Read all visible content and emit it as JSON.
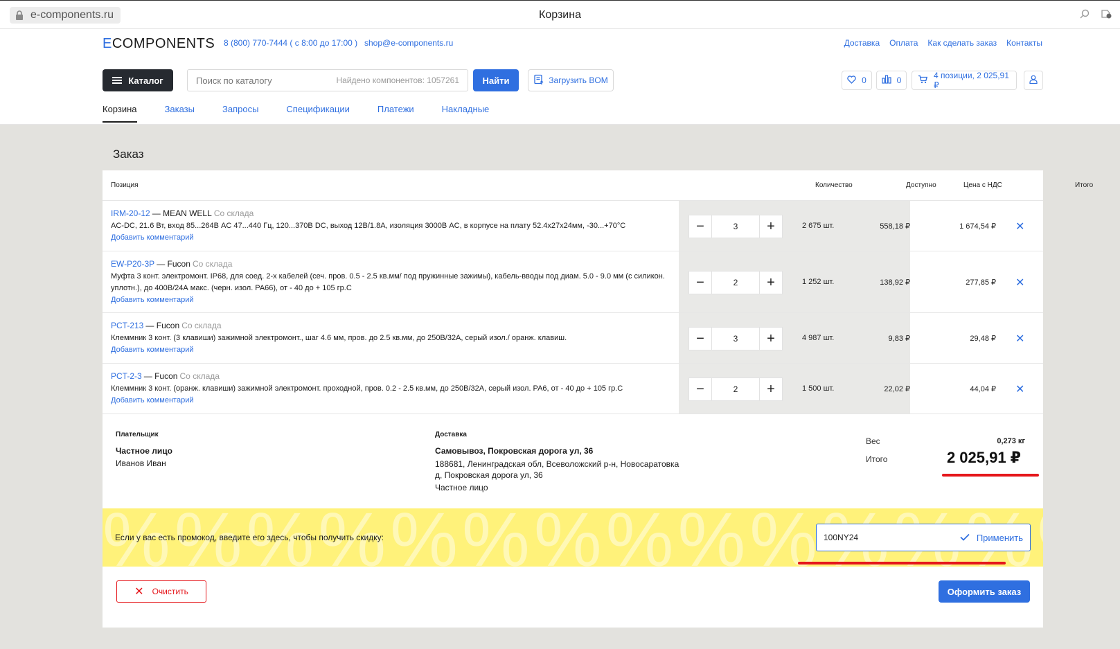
{
  "browser": {
    "url": "e-components.ru",
    "tab_title": "Корзина"
  },
  "header": {
    "logo_first": "E",
    "logo_rest": "COMPONENTS",
    "phone": "8 (800) 770-7444 ( с 8:00 до 17:00 )",
    "email": "shop@e-components.ru",
    "top_links": [
      "Доставка",
      "Оплата",
      "Как сделать заказ",
      "Контакты"
    ],
    "catalog_label": "Каталог",
    "search_placeholder": "Поиск по каталогу",
    "search_found": "Найдено компонентов: 1057261",
    "find_label": "Найти",
    "bom_label": "Загрузить BOM",
    "favorites_count": "0",
    "compare_count": "0",
    "cart_summary": "4 позиции, 2 025,91 ₽",
    "subtabs": [
      "Корзина",
      "Заказы",
      "Запросы",
      "Спецификации",
      "Платежи",
      "Накладные"
    ]
  },
  "order": {
    "title": "Заказ",
    "columns": {
      "position": "Позиция",
      "quantity": "Количество",
      "available": "Доступно",
      "price": "Цена с НДС",
      "total": "Итого"
    },
    "items": [
      {
        "pn": "IRM-20-12",
        "brand": "MEAN WELL",
        "source": "Со склада",
        "desc": "AC-DC, 21.6 Вт, вход 85...264В AC 47...440 Гц, 120...370В DC, выход 12В/1.8А, изоляция 3000В AC, в корпусе на плату 52.4x27x24мм, -30...+70°C",
        "comment": "Добавить комментарий",
        "qty": "3",
        "available": "2 675 шт.",
        "price": "558,18 ₽",
        "total": "1 674,54 ₽"
      },
      {
        "pn": "EW-P20-3P",
        "brand": "Fucon",
        "source": "Со склада",
        "desc": "Муфта 3 конт. электромонт. IP68, для соед. 2-х кабелей (сеч. пров. 0.5 - 2.5 кв.мм/ под пружинные зажимы), кабель-вводы под диам. 5.0 - 9.0 мм (с силикон. уплотн.), до 400В/24А макс. (черн. изол. PA66), от - 40 до + 105 гр.С",
        "comment": "Добавить комментарий",
        "qty": "2",
        "available": "1 252 шт.",
        "price": "138,92 ₽",
        "total": "277,85 ₽"
      },
      {
        "pn": "PCT-213",
        "brand": "Fucon",
        "source": "Со склада",
        "desc": "Клеммник 3 конт. (3 клавиши) зажимной электромонт., шаг 4.6 мм, пров. до 2.5 кв.мм, до 250В/32А, серый изол./ оранж. клавиш.",
        "comment": "Добавить комментарий",
        "qty": "3",
        "available": "4 987 шт.",
        "price": "9,83 ₽",
        "total": "29,48 ₽"
      },
      {
        "pn": "PCT-2-3",
        "brand": "Fucon",
        "source": "Со склада",
        "desc": "Клеммник 3 конт. (оранж. клавиши) зажимной электромонт. проходной, пров. 0.2 - 2.5 кв.мм, до 250В/32А, серый изол. PA6, от - 40 до + 105 гр.С",
        "comment": "Добавить комментарий",
        "qty": "2",
        "available": "1 500 шт.",
        "price": "22,02 ₽",
        "total": "44,04 ₽"
      }
    ],
    "payer": {
      "label": "Плательщик",
      "type": "Частное лицо",
      "name": "Иванов Иван"
    },
    "delivery": {
      "label": "Доставка",
      "method": "Самовывоз, Покровская дорога ул, 36",
      "address_line1": "188681, Ленинградская обл, Всеволожский р-н, Новосаратовка",
      "address_line2": "д, Покровская дорога ул, 36",
      "recipient": "Частное лицо"
    },
    "weight_label": "Вес",
    "weight_value": "0,273 кг",
    "total_label": "Итого",
    "total_value": "2 025,91 ₽",
    "promo_text": "Если у вас есть промокод, введите его здесь, чтобы получить скидку:",
    "promo_code": "100NY24",
    "promo_apply": "Применить",
    "clear_label": "Очистить",
    "submit_label": "Оформить заказ"
  },
  "colors": {
    "accent": "#2f6fe0",
    "danger": "#e5161b",
    "promo_bg": "#fff27a",
    "page_bg": "#e3e2de",
    "dark_button": "#262a30"
  }
}
